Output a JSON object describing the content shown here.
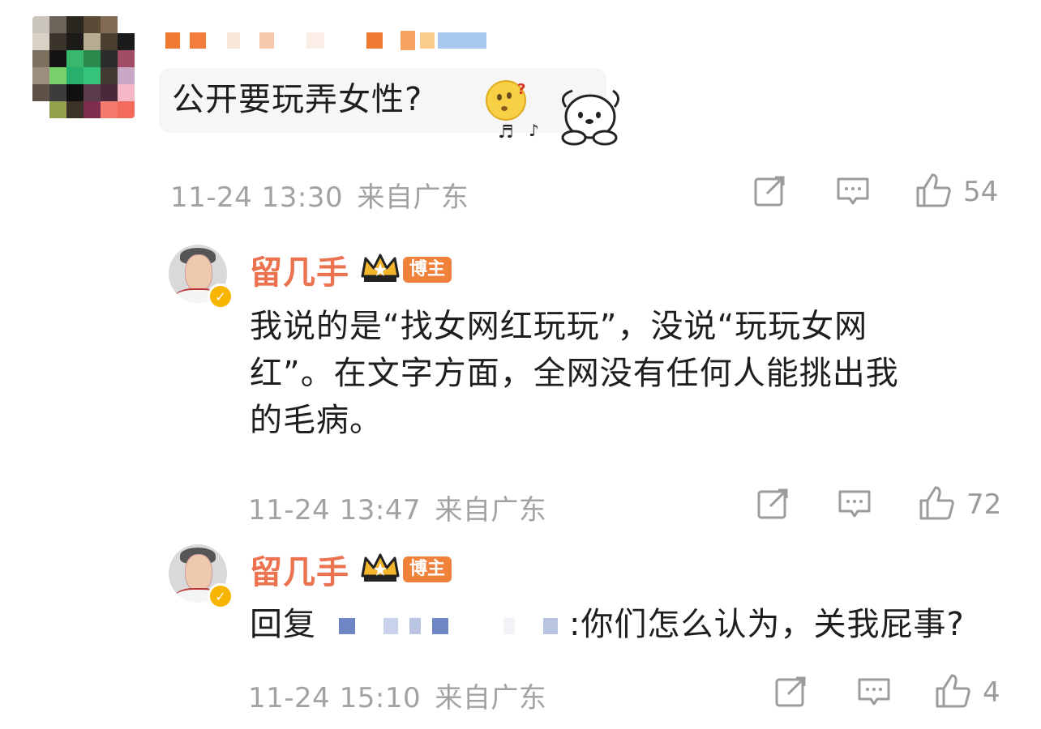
{
  "comments": [
    {
      "text": "公开要玩弄女性?",
      "time": "11-24 13:30",
      "location": "来自广东",
      "likes": "54"
    }
  ],
  "replies": [
    {
      "username": "留几手",
      "badge": "博主",
      "text_lines": [
        "我说的是“找女网红玩玩”，没说“玩玩女网",
        "红”。在文字方面，全网没有任何人能挑出我",
        "的毛病。"
      ],
      "time": "11-24 13:47",
      "location": "来自广东",
      "likes": "72"
    },
    {
      "username": "留几手",
      "badge": "博主",
      "text_prefix": "回复",
      "text_suffix": ":你们怎么认为，关我屁事?",
      "time": "11-24 15:10",
      "location": "来自广东",
      "likes": "4"
    }
  ],
  "colors": {
    "username": "#eb7350",
    "meta": "#a2a2a2",
    "host_tag": "#f0813b",
    "verified": "#f7b500"
  },
  "icons": [
    "share-icon",
    "comment-icon",
    "like-icon",
    "crown-icon",
    "verified-icon",
    "emoji-question-icon",
    "pochacco-sticker-icon"
  ]
}
